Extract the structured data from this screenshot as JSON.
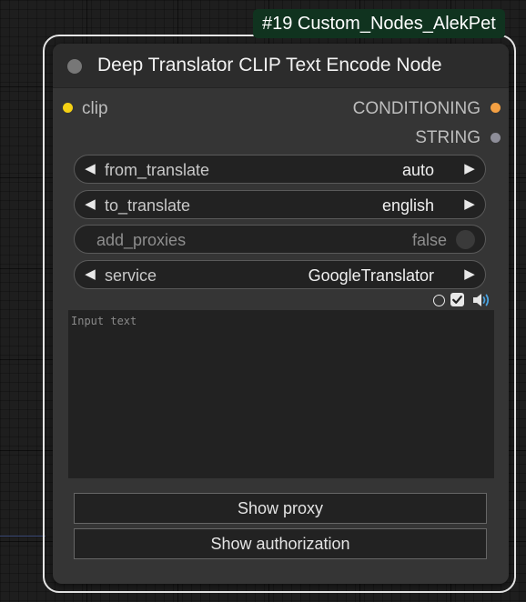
{
  "badge": {
    "text": "#19 Custom_Nodes_AlekPet"
  },
  "node": {
    "title": "Deep Translator CLIP Text Encode Node",
    "inputs": [
      {
        "label": "clip",
        "color": "#f5d114"
      }
    ],
    "outputs": [
      {
        "label": "CONDITIONING",
        "color": "#f4a043"
      },
      {
        "label": "STRING",
        "color": "#8e8e99"
      }
    ]
  },
  "widgets": {
    "from_translate": {
      "label": "from_translate",
      "value": "auto"
    },
    "to_translate": {
      "label": "to_translate",
      "value": "english"
    },
    "add_proxies": {
      "label": "add_proxies",
      "value": "false"
    },
    "service": {
      "label": "service",
      "value": "GoogleTranslator"
    }
  },
  "text_input": {
    "placeholder": "Input text",
    "value": ""
  },
  "buttons": {
    "show_proxy": "Show proxy",
    "show_authorization": "Show authorization"
  },
  "toolbar": {
    "icons": [
      "radio-circle-icon",
      "checkbox-checked-icon",
      "speaker-icon"
    ]
  },
  "colors": {
    "canvas_bg": "#1e1e1e",
    "node_body": "#353535",
    "node_header": "#2c2c2c",
    "widget_bg": "#222222",
    "badge_bg": "#10331f",
    "selection_outline": "#e6e6e6",
    "speaker_accent": "#4aa3e0"
  }
}
